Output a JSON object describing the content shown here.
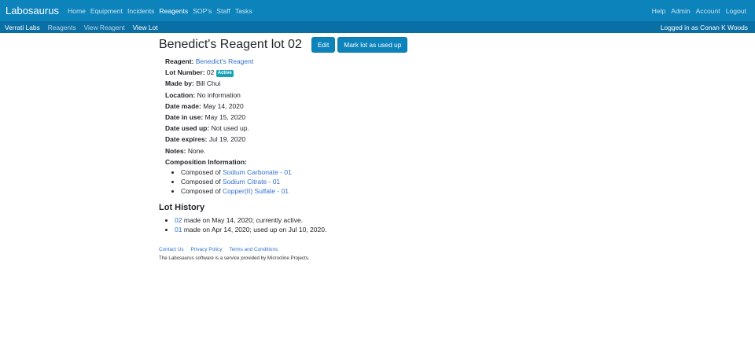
{
  "header": {
    "brand": "Labosaurus",
    "nav": [
      {
        "label": "Home",
        "active": false
      },
      {
        "label": "Equipment",
        "active": false
      },
      {
        "label": "Incidents",
        "active": false
      },
      {
        "label": "Reagents",
        "active": true
      },
      {
        "label": "SOP's",
        "active": false
      },
      {
        "label": "Staff",
        "active": false
      },
      {
        "label": "Tasks",
        "active": false
      }
    ],
    "right_nav": [
      "Help",
      "Admin",
      "Account",
      "Logout"
    ]
  },
  "subheader": {
    "breadcrumbs": [
      "Verrati Labs",
      "Reagents",
      "View Reagent",
      "View Lot"
    ],
    "logged_in": "Logged in as Conan K Woods"
  },
  "page": {
    "title": "Benedict's Reagent lot 02",
    "edit_label": "Edit",
    "mark_used_label": "Mark lot as used up"
  },
  "details": {
    "reagent_label": "Reagent:",
    "reagent_value": "Benedict's Reagent",
    "lot_label": "Lot Number:",
    "lot_value": "02",
    "status_badge": "Active",
    "made_by_label": "Made by:",
    "made_by_value": "Bill Chui",
    "location_label": "Location:",
    "location_value": "No information",
    "date_made_label": "Date made:",
    "date_made_value": "May 14, 2020",
    "date_in_use_label": "Date in use:",
    "date_in_use_value": "May 15, 2020",
    "date_used_up_label": "Date used up:",
    "date_used_up_value": "Not used up.",
    "date_expires_label": "Date expires:",
    "date_expires_value": "Jul 19, 2020",
    "notes_label": "Notes:",
    "notes_value": "None.",
    "composition_label": "Composition Information:"
  },
  "composition": [
    {
      "prefix": "Composed of",
      "link": "Sodium Carbonate - 01"
    },
    {
      "prefix": "Composed of",
      "link": "Sodium Citrate - 01"
    },
    {
      "prefix": "Composed of",
      "link": "Copper(II) Sulfate - 01"
    }
  ],
  "history": {
    "title": "Lot History",
    "items": [
      {
        "lot": "02",
        "text": "made on May 14, 2020; currently active."
      },
      {
        "lot": "01",
        "text": "made on Apr 14, 2020; used up on Jul 10, 2020."
      }
    ]
  },
  "footer": {
    "links": [
      "Contact Us",
      "Privacy Policy",
      "Terms and Conditions"
    ],
    "note": "The Labosaurus software is a service provided by Microcline Projects."
  }
}
